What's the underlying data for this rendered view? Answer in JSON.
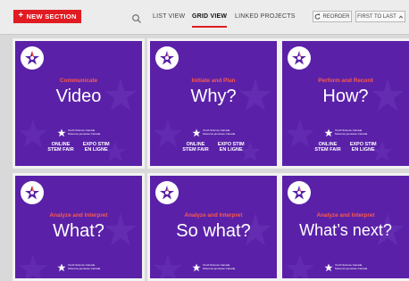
{
  "toolbar": {
    "new_section_label": "NEW SECTION",
    "tabs": [
      {
        "label": "LIST VIEW"
      },
      {
        "label": "GRID VIEW"
      },
      {
        "label": "LINKED PROJECTS"
      }
    ],
    "active_tab": "GRID VIEW",
    "reorder_label": "REORDER",
    "sort_label": "FIRST TO LAST"
  },
  "icons": {
    "search": "search-icon",
    "plus": "plus-icon",
    "reorder": "refresh-icon",
    "sort": "chevron-up-icon",
    "badge": "star-icon",
    "logo": "star-logo-icon"
  },
  "colors": {
    "accent": "#e11b22",
    "card_bg": "#5a21a8",
    "kicker": "#ff5a4a"
  },
  "cards": [
    {
      "kicker": "Communicate",
      "title": "Video",
      "org_line1": "Youth Science Canada",
      "org_line2": "Sciences jeunesse Canada",
      "fair_en_1": "ONLINE",
      "fair_en_2": "STEM FAIR",
      "fair_fr_1": "EXPO STIM",
      "fair_fr_2": "EN LIGNE"
    },
    {
      "kicker": "Initiate and Plan",
      "title": "Why?",
      "org_line1": "Youth Science Canada",
      "org_line2": "Sciences jeunesse Canada",
      "fair_en_1": "ONLINE",
      "fair_en_2": "STEM FAIR",
      "fair_fr_1": "EXPO STIM",
      "fair_fr_2": "EN LIGNE"
    },
    {
      "kicker": "Perform and Record",
      "title": "How?",
      "org_line1": "Youth Science Canada",
      "org_line2": "Sciences jeunesse Canada",
      "fair_en_1": "ONLINE",
      "fair_en_2": "STEM FAIR",
      "fair_fr_1": "EXPO STIM",
      "fair_fr_2": "EN LIGNE"
    },
    {
      "kicker": "Analyze and Interpret",
      "title": "What?",
      "org_line1": "Youth Science Canada",
      "org_line2": "Sciences jeunesse Canada"
    },
    {
      "kicker": "Analyze and Interpret",
      "title": "So what?",
      "org_line1": "Youth Science Canada",
      "org_line2": "Sciences jeunesse Canada"
    },
    {
      "kicker": "Analyze and Interpret",
      "title": "What’s next?",
      "org_line1": "Youth Science Canada",
      "org_line2": "Sciences jeunesse Canada"
    }
  ]
}
